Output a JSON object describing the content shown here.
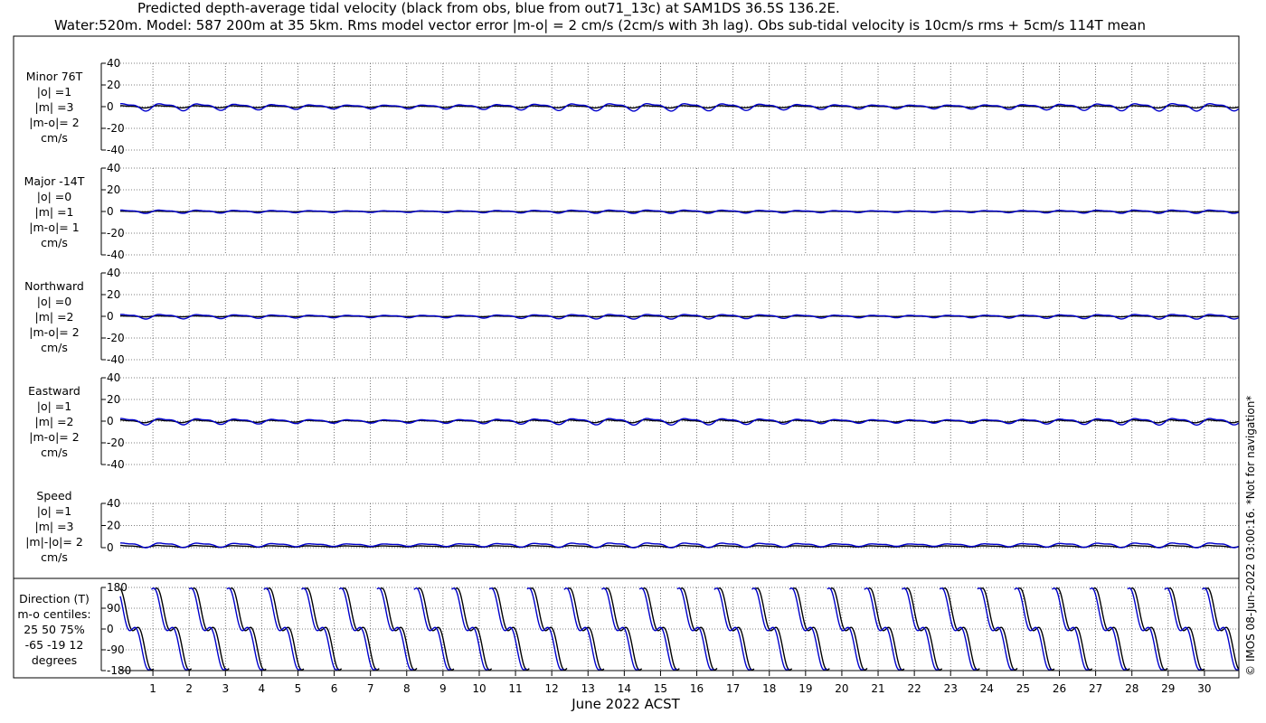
{
  "title_line1": "Predicted depth-average tidal velocity (black from obs, blue from out71_13c) at SAM1DS 36.5S 136.2E.",
  "title_line2": "Water:520m. Model: 587 200m at 35 5km. Rms model vector error |m-o| = 2 cm/s (2cm/s with 3h lag). Obs sub-tidal velocity is 10cm/s rms + 5cm/s 114T mean",
  "credit": "© IMOS 08-Jun-2022 03:00:16. *Not for navigation*",
  "colors": {
    "obs": "#000000",
    "model": "#0000cc",
    "grid": "#555555"
  },
  "chart_data": {
    "type": "line",
    "xlabel": "June 2022 ACST",
    "x_ticks": [
      "1",
      "2",
      "3",
      "4",
      "5",
      "6",
      "7",
      "8",
      "9",
      "10",
      "11",
      "12",
      "13",
      "14",
      "15",
      "16",
      "17",
      "18",
      "19",
      "20",
      "21",
      "22",
      "23",
      "24",
      "25",
      "26",
      "27",
      "28",
      "29",
      "30"
    ],
    "xlim": [
      0.1,
      30.95
    ],
    "legend": "none",
    "grid": true,
    "series_names": [
      "obs",
      "model"
    ],
    "panels": [
      {
        "name": "minor",
        "label_lines": [
          "Minor 76T",
          "|o| =1",
          "|m| =3",
          "|m-o|= 2",
          "cm/s"
        ],
        "ylim": [
          -40,
          40
        ],
        "yticks": [
          "40",
          "20",
          "0",
          "-20",
          "-40"
        ],
        "yvals": [
          40,
          20,
          0,
          -20,
          -40
        ],
        "obs": {
          "amp": 1.2,
          "phase": 0.3,
          "mean": 0
        },
        "model": {
          "amp": 4.0,
          "phase": 0.0,
          "mean": 0
        }
      },
      {
        "name": "major",
        "label_lines": [
          "Major -14T",
          "|o| =0",
          "|m| =1",
          "|m-o|= 1",
          "cm/s"
        ],
        "ylim": [
          -40,
          40
        ],
        "yticks": [
          "40",
          "20",
          "0",
          "-20",
          "-40"
        ],
        "yvals": [
          40,
          20,
          0,
          -20,
          -40
        ],
        "obs": {
          "amp": 0.4,
          "phase": 0.3,
          "mean": 0
        },
        "model": {
          "amp": 1.8,
          "phase": 0.1,
          "mean": 0
        }
      },
      {
        "name": "northward",
        "label_lines": [
          "Northward",
          "|o| =0",
          "|m| =2",
          "|m-o|= 2",
          "cm/s"
        ],
        "ylim": [
          -40,
          40
        ],
        "yticks": [
          "40",
          "20",
          "0",
          "-20",
          "-40"
        ],
        "yvals": [
          40,
          20,
          0,
          -20,
          -40
        ],
        "obs": {
          "amp": 0.5,
          "phase": 0.3,
          "mean": 0
        },
        "model": {
          "amp": 2.5,
          "phase": 0.0,
          "mean": 0
        }
      },
      {
        "name": "eastward",
        "label_lines": [
          "Eastward",
          "|o| =1",
          "|m| =2",
          "|m-o|= 2",
          "cm/s"
        ],
        "ylim": [
          -40,
          40
        ],
        "yticks": [
          "40",
          "20",
          "0",
          "-20",
          "-40"
        ],
        "yvals": [
          40,
          20,
          0,
          -20,
          -40
        ],
        "obs": {
          "amp": 1.5,
          "phase": 0.4,
          "mean": 0
        },
        "model": {
          "amp": 3.5,
          "phase": 0.0,
          "mean": 0
        }
      },
      {
        "name": "speed",
        "label_lines": [
          "Speed",
          "|o| =1",
          "|m| =3",
          "|m|-|o|= 2",
          "cm/s"
        ],
        "ylim": [
          0,
          40
        ],
        "yticks": [
          "40",
          "20",
          "0"
        ],
        "yvals": [
          40,
          20,
          0
        ],
        "obs": {
          "amp": 1.0,
          "phase": 0.3,
          "mean": 1.2
        },
        "model": {
          "amp": 2.5,
          "phase": 0.0,
          "mean": 2.5
        }
      },
      {
        "name": "direction",
        "label_lines": [
          "Direction (T)",
          "m-o centiles:",
          "25  50  75%",
          "-65  -19  12",
          "degrees"
        ],
        "ylim": [
          -180,
          180
        ],
        "yticks": [
          "180",
          "90",
          "0",
          "-90",
          "-180"
        ],
        "yvals": [
          180,
          90,
          0,
          -90,
          -180
        ],
        "direction": true
      }
    ]
  }
}
